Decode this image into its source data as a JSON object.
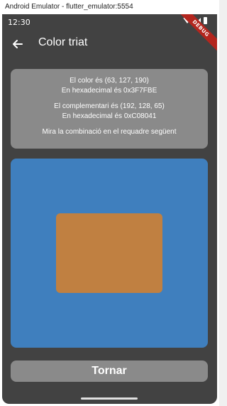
{
  "window": {
    "title": "Android Emulator - flutter_emulator:5554"
  },
  "status_bar": {
    "time": "12:30",
    "icons": [
      "wifi-icon",
      "signal-icon",
      "battery-icon"
    ]
  },
  "debug_banner": "DEBUG",
  "app_bar": {
    "title": "Color triat",
    "back_icon": "arrow-back-icon"
  },
  "info": {
    "color_line": "El color és (63, 127, 190)",
    "color_hex_line": "En hexadecimal és 0x3F7FBE",
    "complement_line": "El complementari és (192, 128, 65)",
    "complement_hex_line": "En hexadecimal és 0xC08041",
    "hint_line": "Mira la combinació en el requadre següent"
  },
  "colors": {
    "chosen": "#3F7FBE",
    "complement": "#C08041",
    "card": "#8A8A8A",
    "background": "#424242"
  },
  "button": {
    "label": "Tornar"
  }
}
